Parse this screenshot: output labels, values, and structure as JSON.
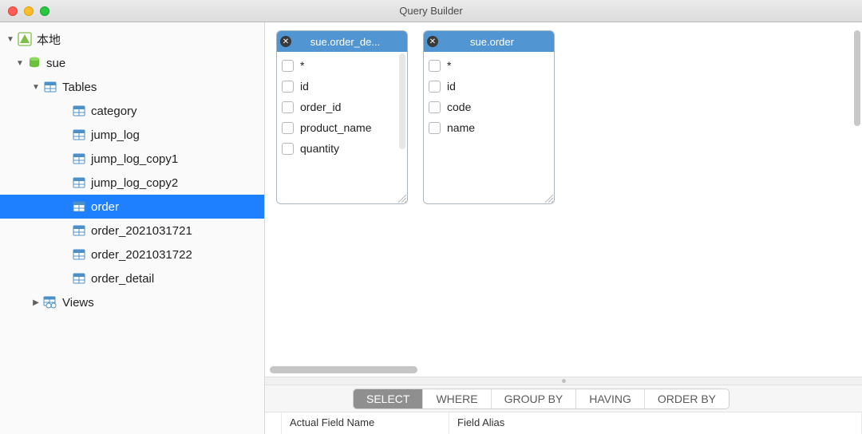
{
  "window": {
    "title": "Query Builder"
  },
  "tree": {
    "root": {
      "label": "本地"
    },
    "db": {
      "label": "sue"
    },
    "tables_node": {
      "label": "Tables"
    },
    "tables": [
      {
        "label": "category"
      },
      {
        "label": "jump_log"
      },
      {
        "label": "jump_log_copy1"
      },
      {
        "label": "jump_log_copy2"
      },
      {
        "label": "order",
        "selected": true
      },
      {
        "label": "order_2021031721"
      },
      {
        "label": "order_2021031722"
      },
      {
        "label": "order_detail"
      }
    ],
    "views_node": {
      "label": "Views"
    }
  },
  "cards": [
    {
      "title": "sue.order_de...",
      "fields": [
        "*",
        "id",
        "order_id",
        "product_name",
        "quantity"
      ]
    },
    {
      "title": "sue.order",
      "fields": [
        "*",
        "id",
        "code",
        "name"
      ]
    }
  ],
  "tabs": {
    "select": "SELECT",
    "where": "WHERE",
    "groupby": "GROUP BY",
    "having": "HAVING",
    "orderby": "ORDER BY"
  },
  "grid": {
    "col1": "Actual Field Name",
    "col2": "Field Alias"
  }
}
